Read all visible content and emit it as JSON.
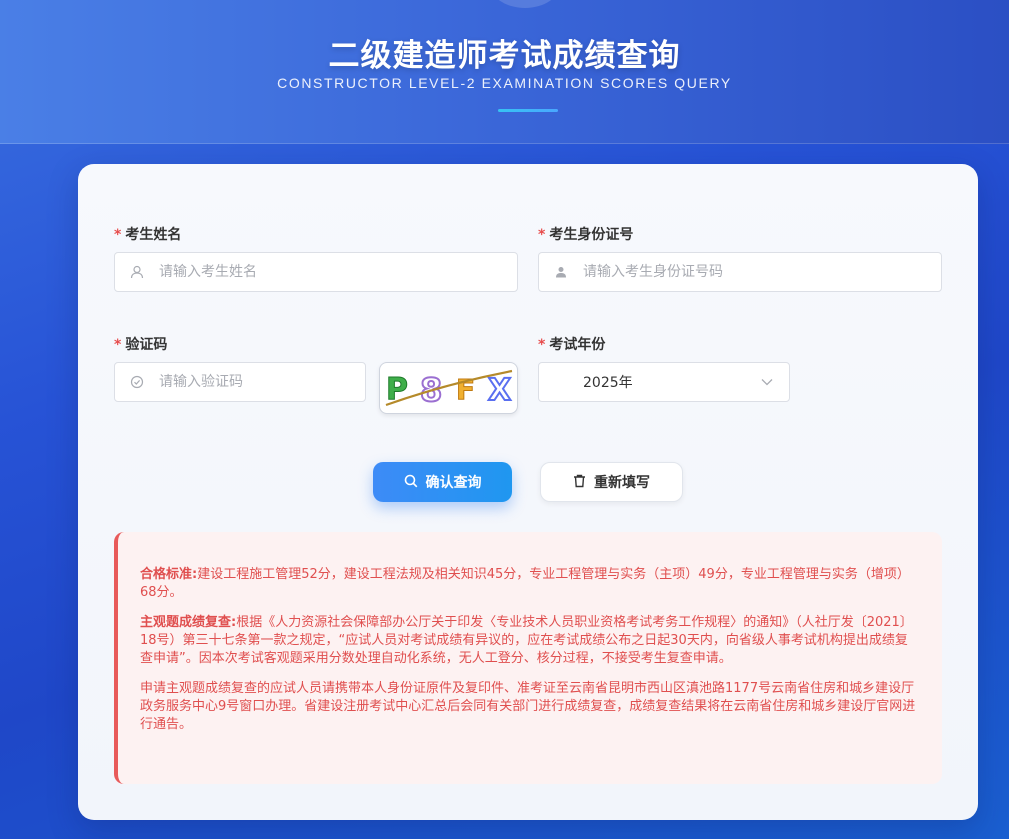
{
  "header": {
    "title": "二级建造师考试成绩查询",
    "subtitle": "CONSTRUCTOR LEVEL-2 EXAMINATION SCORES QUERY"
  },
  "form": {
    "required_mark": "*",
    "name": {
      "label": "考生姓名",
      "placeholder": "请输入考生姓名",
      "value": ""
    },
    "id_number": {
      "label": "考生身份证号",
      "placeholder": "请输入考生身份证号码",
      "value": ""
    },
    "captcha": {
      "label": "验证码",
      "placeholder": "请输入验证码",
      "value": "",
      "image_chars": [
        "P",
        "8",
        "F",
        "X"
      ]
    },
    "year": {
      "label": "考试年份",
      "selected": "2025年"
    },
    "submit_label": "确认查询",
    "reset_label": "重新填写"
  },
  "notice": {
    "p1_label": "合格标准:",
    "p1_text": "建设工程施工管理52分，建设工程法规及相关知识45分，专业工程管理与实务（主项）49分，专业工程管理与实务（增项）68分。",
    "p2_label": "主观题成绩复查:",
    "p2_text": "根据《人力资源社会保障部办公厅关于印发〈专业技术人员职业资格考试考务工作规程〉的通知》（人社厅发〔2021〕18号）第三十七条第一款之规定，“应试人员对考试成绩有异议的，应在考试成绩公布之日起30天内，向省级人事考试机构提出成绩复查申请”。因本次考试客观题采用分数处理自动化系统，无人工登分、核分过程，不接受考生复查申请。",
    "p3_text": "申请主观题成绩复查的应试人员请携带本人身份证原件及复印件、准考证至云南省昆明市西山区滇池路1177号云南省住房和城乡建设厅政务服务中心9号窗口办理。省建设注册考试中心汇总后会同有关部门进行成绩复查，成绩复查结果将在云南省住房和城乡建设厅官网进行通告。"
  },
  "colors": {
    "accent": "#2f8cf5",
    "required": "#e74c4c",
    "notice_text": "#e04f4f",
    "notice_bg": "#fdf2f2"
  },
  "icons": {
    "name": "user-icon",
    "id_number": "person-icon",
    "captcha": "check-circle-icon",
    "year": "chevron-down-icon",
    "submit": "search-icon",
    "reset": "trash-icon"
  }
}
